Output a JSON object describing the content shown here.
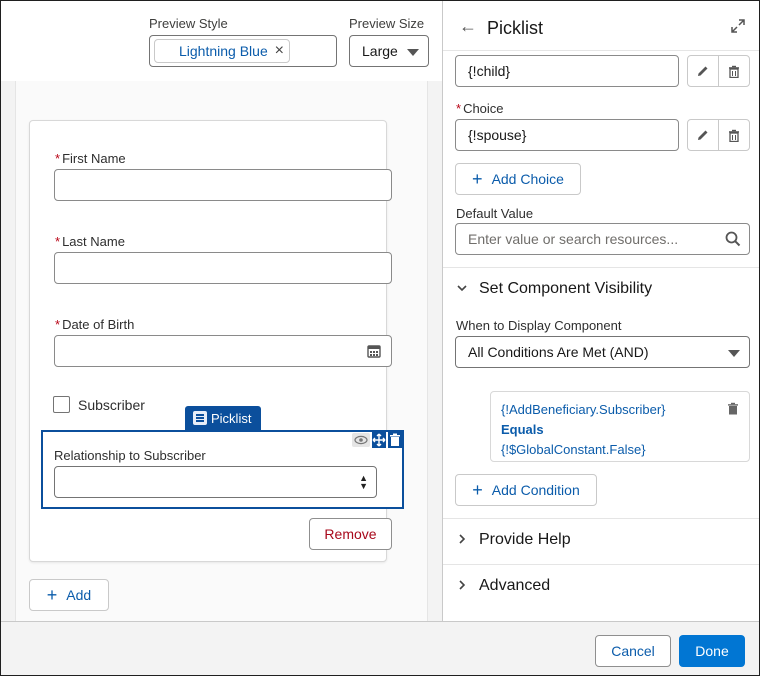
{
  "preview": {
    "style_label": "Preview Style",
    "style_value": "Lightning Blue",
    "size_label": "Preview Size",
    "size_value": "Large"
  },
  "form": {
    "fields": [
      {
        "label": "First Name",
        "required": true,
        "value": ""
      },
      {
        "label": "Last Name",
        "required": true,
        "value": ""
      },
      {
        "label": "Date of Birth",
        "required": true,
        "value": ""
      }
    ],
    "subscriber_label": "Subscriber",
    "subscriber_checked": false,
    "picklist_tab": "Picklist",
    "relationship_label": "Relationship to Subscriber",
    "relationship_value": "",
    "remove_label": "Remove",
    "add_label": "Add"
  },
  "panel": {
    "title": "Picklist",
    "choice_1_value": "{!child}",
    "choice_label": "Choice",
    "choice_2_value": "{!spouse}",
    "add_choice_label": "Add Choice",
    "default_value_label": "Default Value",
    "default_value_placeholder": "Enter value or search resources...",
    "visibility_title": "Set Component Visibility",
    "when_label": "When to Display Component",
    "when_value": "All Conditions Are Met (AND)",
    "condition": {
      "resource": "{!AddBeneficiary.Subscriber}",
      "operator": "Equals",
      "value": "{!$GlobalConstant.False}"
    },
    "add_condition_label": "Add Condition",
    "provide_help_title": "Provide Help",
    "advanced_title": "Advanced"
  },
  "footer": {
    "cancel_label": "Cancel",
    "done_label": "Done"
  },
  "colors": {
    "brand": "#0176d3",
    "link": "#0b5cab",
    "selection": "#0b4f9c",
    "required": "#ba0517",
    "destructive": "#a8081b"
  }
}
